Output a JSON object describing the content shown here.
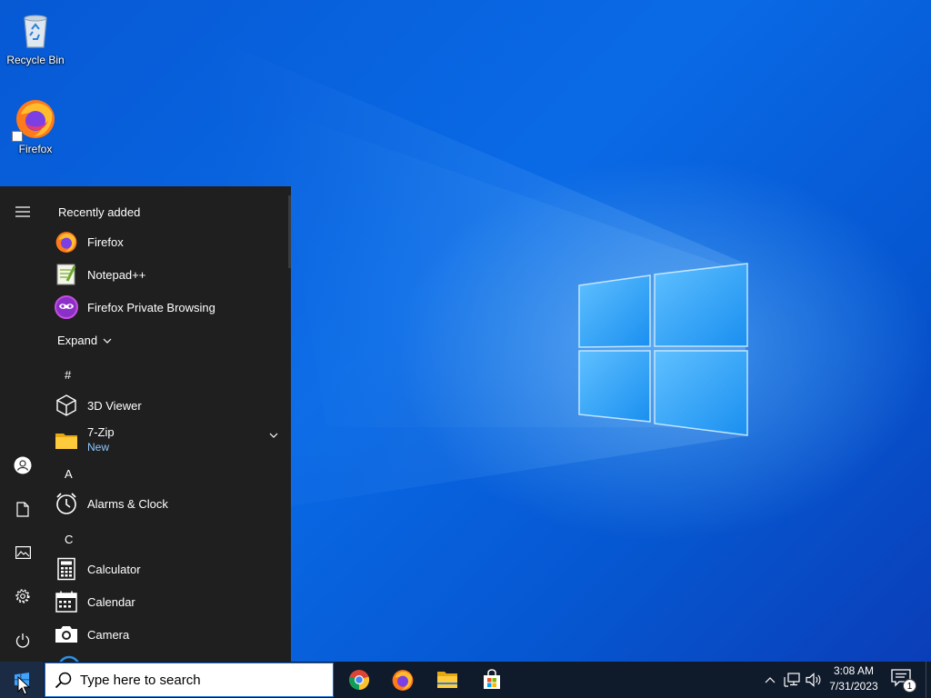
{
  "desktop": {
    "icons": [
      {
        "label": "Recycle Bin",
        "icon": "recycle-bin-icon"
      },
      {
        "label": "Firefox",
        "icon": "firefox-icon"
      }
    ]
  },
  "start_menu": {
    "rail": [
      {
        "name": "expand-menu-button",
        "icon": "hamburger-icon"
      },
      {
        "name": "user-account-button",
        "icon": "user-icon"
      },
      {
        "name": "documents-button",
        "icon": "document-icon"
      },
      {
        "name": "pictures-button",
        "icon": "pictures-icon"
      },
      {
        "name": "settings-button",
        "icon": "gear-icon"
      },
      {
        "name": "power-button",
        "icon": "power-icon"
      }
    ],
    "recently_added_label": "Recently added",
    "recent_apps": [
      {
        "label": "Firefox",
        "icon": "firefox-icon"
      },
      {
        "label": "Notepad++",
        "icon": "notepad-plus-plus-icon"
      },
      {
        "label": "Firefox Private Browsing",
        "icon": "firefox-private-icon"
      }
    ],
    "expand_label": "Expand",
    "groups": [
      {
        "letter": "#",
        "apps": [
          {
            "label": "3D Viewer",
            "icon": "cube-icon"
          },
          {
            "label": "7-Zip",
            "sub": "New",
            "icon": "folder-icon",
            "expandable": true
          }
        ]
      },
      {
        "letter": "A",
        "apps": [
          {
            "label": "Alarms & Clock",
            "icon": "alarm-clock-icon"
          }
        ]
      },
      {
        "letter": "C",
        "apps": [
          {
            "label": "Calculator",
            "icon": "calculator-icon"
          },
          {
            "label": "Calendar",
            "icon": "calendar-icon"
          },
          {
            "label": "Camera",
            "icon": "camera-icon"
          }
        ]
      }
    ]
  },
  "taskbar": {
    "search_placeholder": "Type here to search",
    "pinned": [
      {
        "name": "chrome",
        "icon": "chrome-icon"
      },
      {
        "name": "firefox",
        "icon": "firefox-icon"
      },
      {
        "name": "file-explorer",
        "icon": "folder-icon"
      },
      {
        "name": "microsoft-store",
        "icon": "store-icon"
      }
    ],
    "tray": {
      "time": "3:08 AM",
      "date": "7/31/2023",
      "notification_count": "1"
    }
  },
  "colors": {
    "accent": "#0078d7",
    "menu_bg": "#1f1f1f",
    "taskbar_bg": "#0f1a2b",
    "link_blue": "#8ec8ff"
  }
}
